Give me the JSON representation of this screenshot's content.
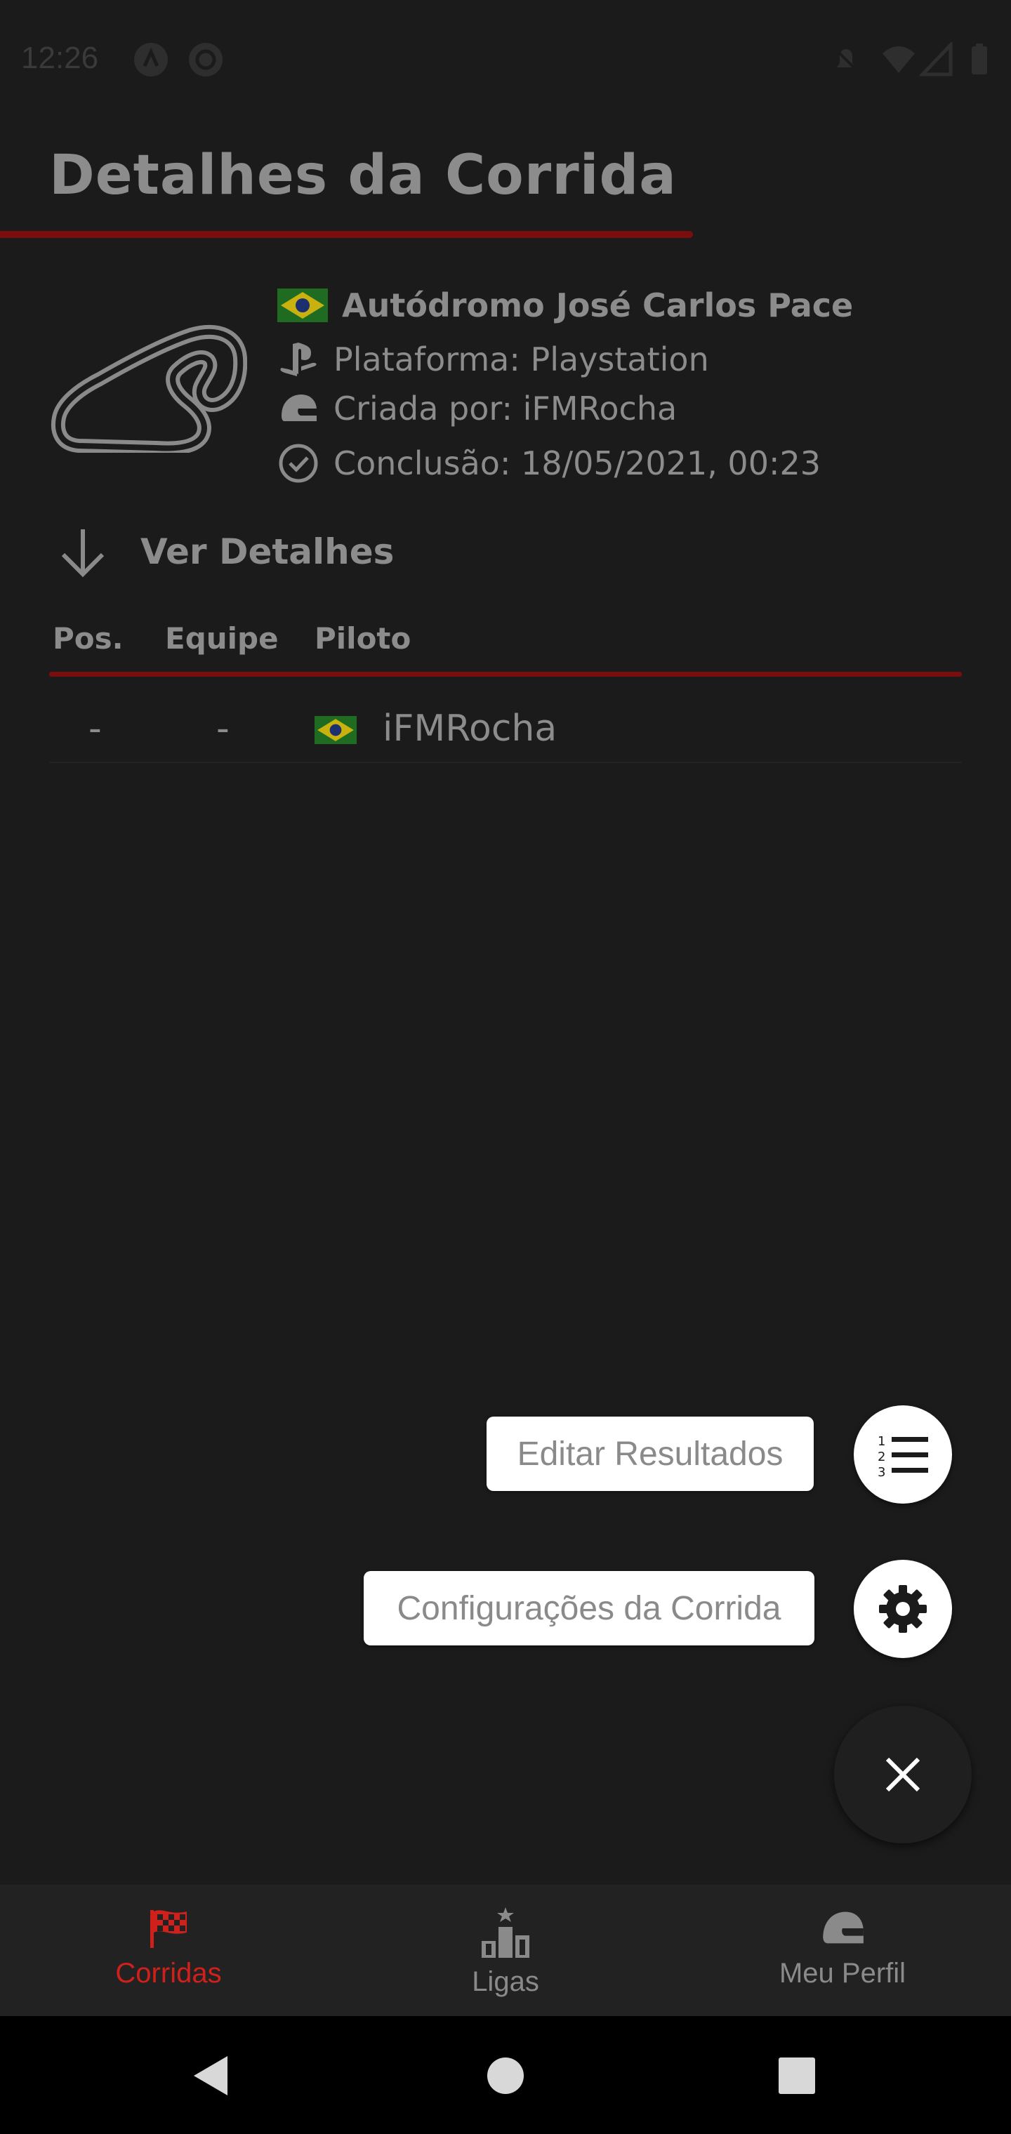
{
  "status_bar": {
    "time": "12:26"
  },
  "header": {
    "title": "Detalhes da Corrida"
  },
  "race": {
    "track_name": "Autódromo José Carlos Pace",
    "platform": "Plataforma: Playstation",
    "created_by": "Criada por: iFMRocha",
    "conclusion": "Conclusão: 18/05/2021, 00:23",
    "flag_icon": "brazil-flag-icon"
  },
  "details_toggle": {
    "label": "Ver Detalhes"
  },
  "results_table": {
    "columns": [
      "Pos.",
      "Equipe",
      "Piloto"
    ],
    "rows": [
      {
        "pos": "-",
        "team": "-",
        "driver": "iFMRocha",
        "flag_icon": "brazil-flag-icon"
      }
    ]
  },
  "fab_menu": {
    "actions": [
      {
        "label": "Editar Resultados",
        "icon": "numbered-list-icon"
      },
      {
        "label": "Configurações da Corrida",
        "icon": "gear-icon"
      }
    ],
    "main_icon": "close-icon"
  },
  "bottom_nav": {
    "items": [
      {
        "label": "Corridas",
        "icon": "checkered-flag-icon",
        "active": true
      },
      {
        "label": "Ligas",
        "icon": "podium-icon",
        "active": false
      },
      {
        "label": "Meu Perfil",
        "icon": "helmet-icon",
        "active": false
      }
    ]
  },
  "colors": {
    "accent": "#d0201b",
    "rule": "#7a0e0e",
    "background": "#1b1b1b"
  }
}
